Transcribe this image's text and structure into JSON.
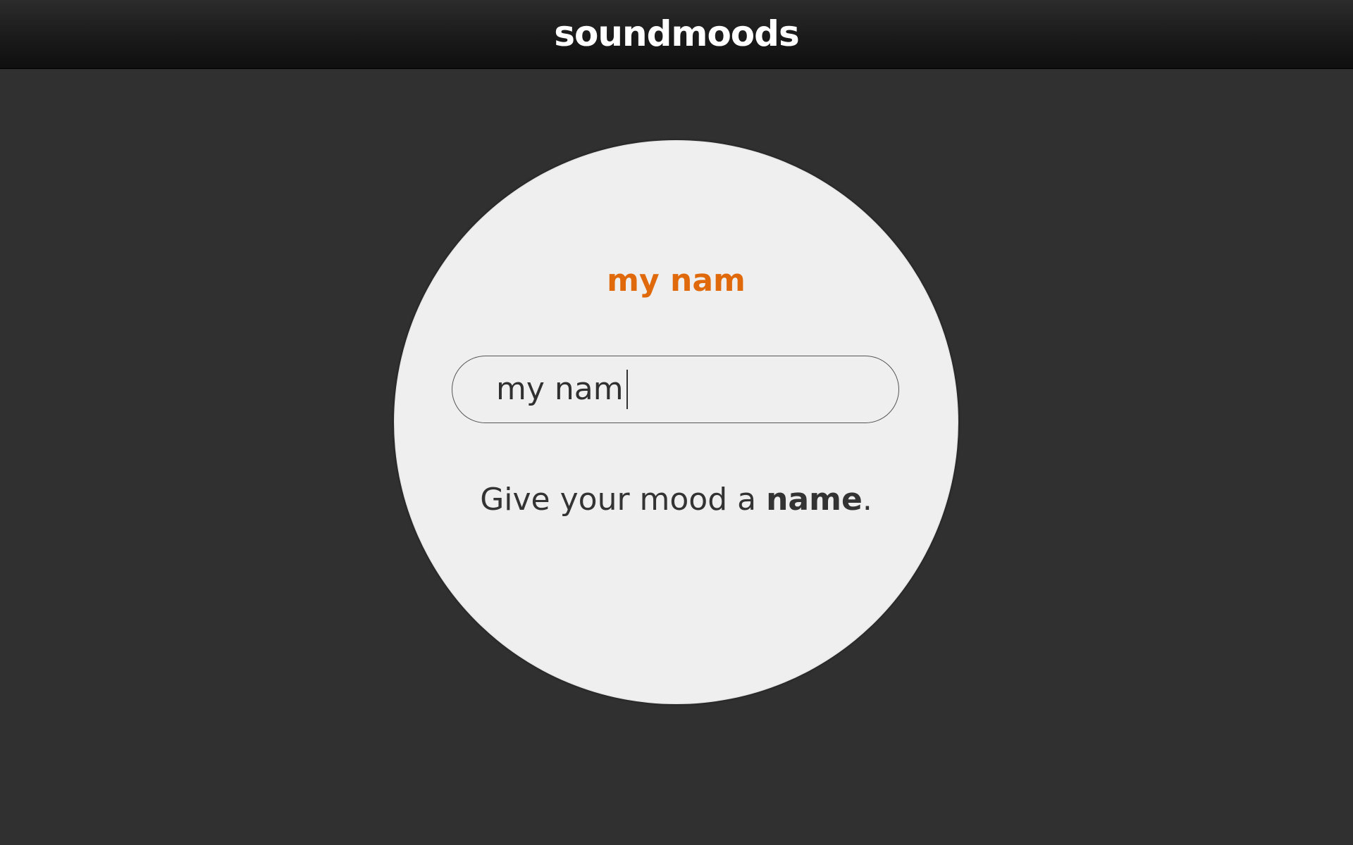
{
  "header": {
    "logo_text": "soundmoods"
  },
  "mood": {
    "title": "my nam",
    "name_input_value": "my nam"
  },
  "hint": {
    "prefix": "Give your mood a ",
    "emphasis": "name",
    "suffix": "."
  },
  "colors": {
    "background": "#303030",
    "header": "#1a1a1a",
    "circle": "#efefef",
    "accent": "#e06a0b",
    "text": "#333333"
  }
}
